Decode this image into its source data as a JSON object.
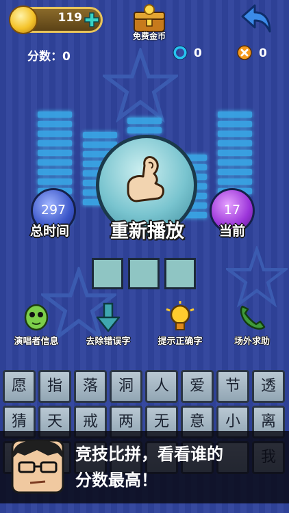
{
  "header": {
    "coins": "119",
    "free_coins_label": "免费金币"
  },
  "stats": {
    "score_label": "分数：0",
    "correct_count": "0",
    "wrong_count": "0"
  },
  "player": {
    "replay_label": "重新播放",
    "total_time_value": "297",
    "total_time_label": "总时间",
    "current_value": "17",
    "current_label": "当前"
  },
  "tools": [
    {
      "label": "演唱者信息",
      "icon": "alien-icon"
    },
    {
      "label": "去除错误字",
      "icon": "remove-arrow-icon"
    },
    {
      "label": "提示正确字",
      "icon": "lightbulb-icon"
    },
    {
      "label": "场外求助",
      "icon": "phone-icon"
    }
  ],
  "letters": {
    "row1": [
      "愿",
      "指",
      "落",
      "洞",
      "人",
      "爱",
      "节",
      "透"
    ],
    "row2": [
      "猜",
      "天",
      "戒",
      "两",
      "无",
      "意",
      "小",
      "离"
    ],
    "row3": [
      "",
      "",
      "",
      "",
      "",
      "",
      "",
      "我"
    ]
  },
  "banner": {
    "line1": "竞技比拼，看看谁的",
    "line2": "分数最高！"
  },
  "colors": {
    "accent": "#3aa9e8",
    "background": "#2e4196"
  }
}
